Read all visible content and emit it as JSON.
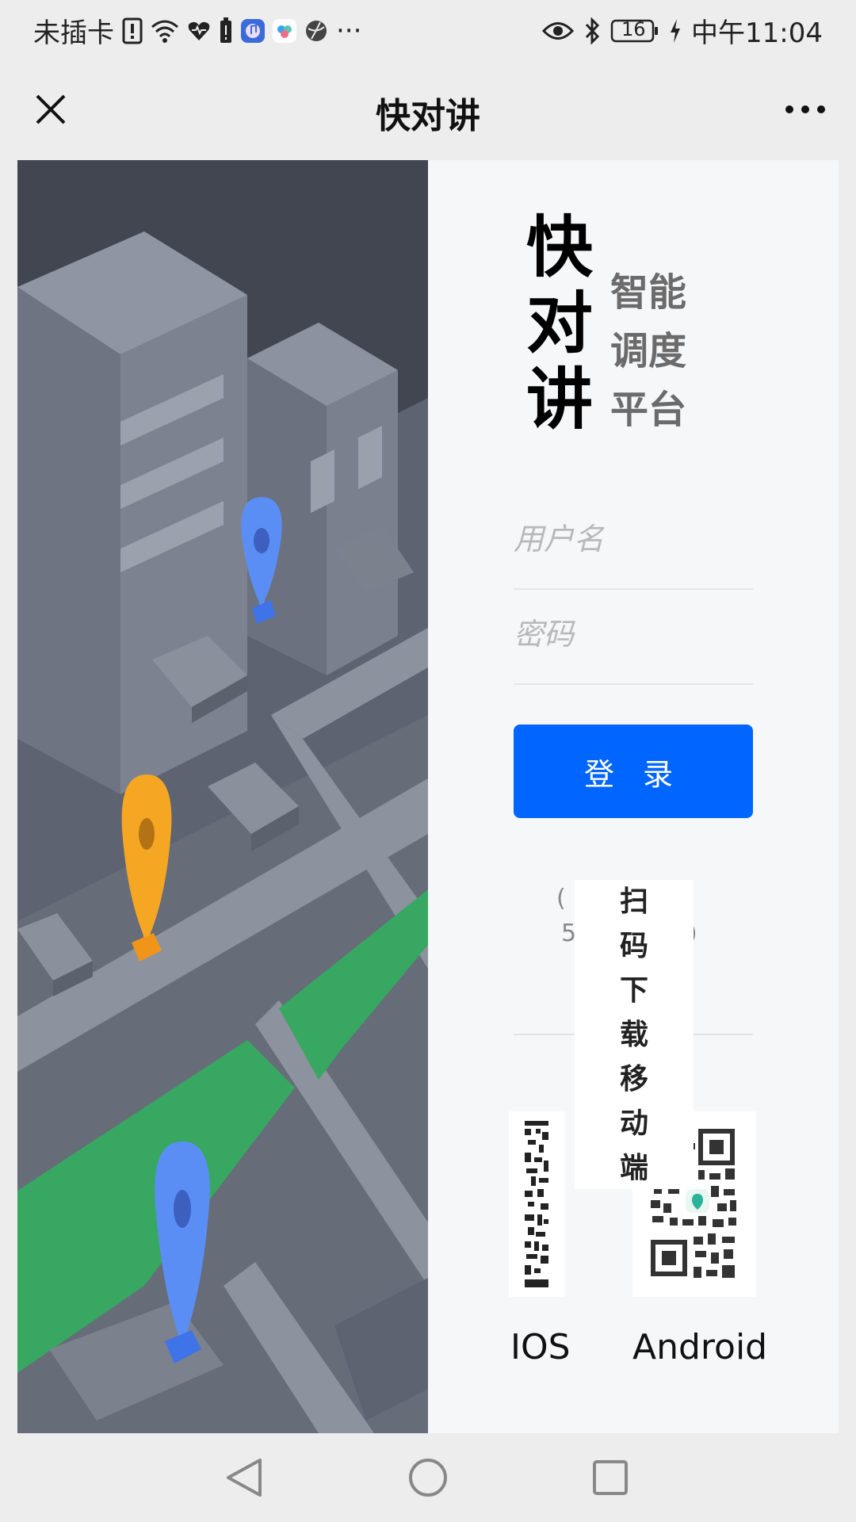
{
  "status_bar": {
    "carrier": "未插卡",
    "battery": "16",
    "time": "中午11:04",
    "more": "···"
  },
  "app_bar": {
    "title": "快对讲"
  },
  "brand": {
    "name_chars": [
      "快",
      "对",
      "讲"
    ],
    "slogan_lines": [
      "智能",
      "调度",
      "平台"
    ]
  },
  "form": {
    "username_placeholder": "用户名",
    "password_placeholder": "密码",
    "login_label": "登 录"
  },
  "note": {
    "line1_visible": "(",
    "line2_visible": "5",
    "line2_end": ")"
  },
  "download": {
    "popup_chars": [
      "扫",
      "码",
      "下",
      "载",
      "移",
      "动",
      "端"
    ],
    "ios_label": "IOS",
    "android_label": "Android"
  },
  "colors": {
    "accent": "#0066ff",
    "pin_blue": "#5b8ef5",
    "pin_orange": "#f5a623",
    "grass": "#3aa860"
  }
}
